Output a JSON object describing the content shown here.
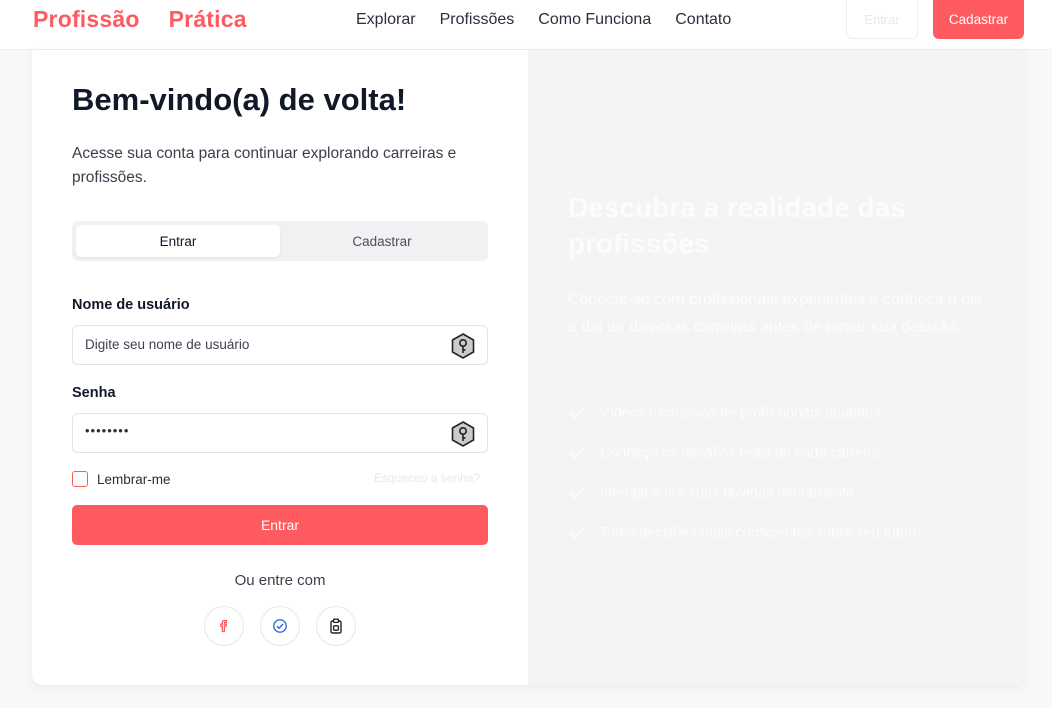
{
  "header": {
    "brand_word1": "Profissão",
    "brand_word2": "Prática",
    "nav": [
      "Explorar",
      "Profissões",
      "Como Funciona",
      "Contato"
    ],
    "login_label": "Entrar",
    "signup_label": "Cadastrar"
  },
  "login": {
    "title": "Bem-vindo(a) de volta!",
    "subtitle": "Acesse sua conta para continuar explorando carreiras e profissões.",
    "tabs": [
      "Entrar",
      "Cadastrar"
    ],
    "username_label": "Nome de usuário",
    "username_placeholder": "Digite seu nome de usuário",
    "password_label": "Senha",
    "password_value": "••••••••",
    "remember_label": "Lembrar-me",
    "forgot_label": "Esqueceu a senha?",
    "submit_label": "Entrar",
    "or_label": "Ou entre com",
    "social": [
      "facebook-icon",
      "check-circle-icon",
      "clipboard-icon"
    ]
  },
  "hero": {
    "title": "Descubra a realidade das profissões",
    "description": "Conecte-se com profissionais experientes e conheça o dia a dia de diversas carreiras antes de tomar sua decisão.",
    "features": [
      "Vídeos exclusivos de profissionais atuantes",
      "Conheça os desafios reais de cada carreira",
      "Interaja e tire suas dúvidas diretamente",
      "Tome decisões mais conscientes sobre seu futuro"
    ]
  },
  "colors": {
    "accent": "#ff5a5f",
    "text": "#111827",
    "pane": "#f4f4f3"
  }
}
